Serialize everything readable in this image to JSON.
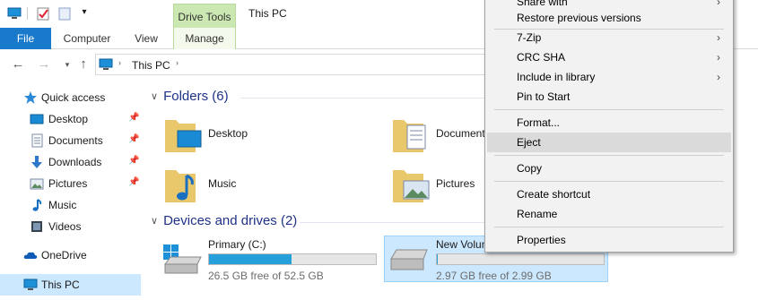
{
  "window": {
    "title": "This PC"
  },
  "context_tab_group": {
    "label": "Drive Tools"
  },
  "ribbon": {
    "tabs": [
      {
        "label": "File"
      },
      {
        "label": "Computer"
      },
      {
        "label": "View"
      },
      {
        "label": "Manage"
      }
    ]
  },
  "address": {
    "path": [
      "This PC"
    ]
  },
  "navpane": {
    "items": [
      {
        "label": "Quick access",
        "icon": "star-icon",
        "pinned": false
      },
      {
        "label": "Desktop",
        "icon": "desktop-folder-icon",
        "pinned": true
      },
      {
        "label": "Documents",
        "icon": "documents-folder-icon",
        "pinned": true
      },
      {
        "label": "Downloads",
        "icon": "downloads-folder-icon",
        "pinned": true
      },
      {
        "label": "Pictures",
        "icon": "pictures-folder-icon",
        "pinned": true
      },
      {
        "label": "Music",
        "icon": "music-folder-icon",
        "pinned": false
      },
      {
        "label": "Videos",
        "icon": "videos-folder-icon",
        "pinned": false
      },
      {
        "label": "OneDrive",
        "icon": "onedrive-icon",
        "pinned": false
      },
      {
        "label": "This PC",
        "icon": "this-pc-icon",
        "pinned": false,
        "selected": true
      }
    ]
  },
  "content": {
    "folders_header": "Folders (6)",
    "folders": [
      {
        "label": "Desktop",
        "icon": "desktop-folder-icon"
      },
      {
        "label": "Documents",
        "icon": "documents-folder-icon"
      },
      {
        "label": "Music",
        "icon": "music-folder-icon"
      },
      {
        "label": "Pictures",
        "icon": "pictures-folder-icon"
      }
    ],
    "drives_header": "Devices and drives (2)",
    "drives": [
      {
        "name": "Primary (C:)",
        "free": "26.5 GB free of 52.5 GB",
        "used_fraction": 0.495,
        "icon": "windows-drive-icon"
      },
      {
        "name": "New Volume",
        "free": "2.97 GB free of 2.99 GB",
        "used_fraction": 0.007,
        "icon": "drive-icon",
        "selected": true
      }
    ]
  },
  "context_menu": {
    "items": [
      {
        "label": "Share with",
        "submenu": true
      },
      {
        "label": "Restore previous versions"
      },
      {
        "label": "7-Zip",
        "submenu": true
      },
      {
        "label": "CRC SHA",
        "submenu": true
      },
      {
        "label": "Include in library",
        "submenu": true
      },
      {
        "label": "Pin to Start"
      },
      {
        "label": "Format..."
      },
      {
        "label": "Eject",
        "highlighted": true
      },
      {
        "label": "Copy"
      },
      {
        "label": "Create shortcut"
      },
      {
        "label": "Rename"
      },
      {
        "label": "Properties"
      }
    ]
  },
  "colors": {
    "file_tab": "#1979ca",
    "drive_tools": "#cbe8b2",
    "selection": "#cce8ff",
    "progress": "#26a0da",
    "group_header": "#1e3287"
  }
}
